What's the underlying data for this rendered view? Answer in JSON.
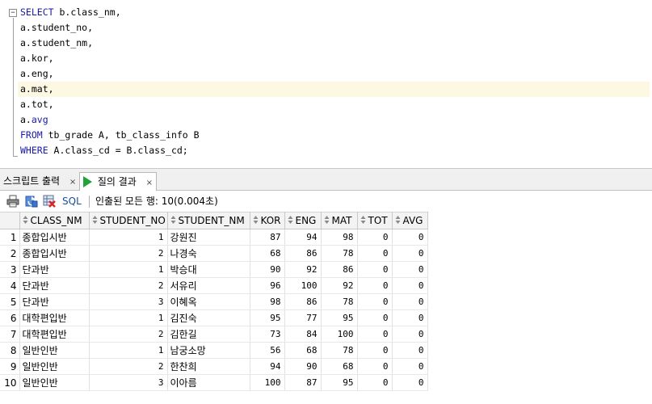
{
  "editor": {
    "lines": [
      {
        "segments": [
          {
            "t": "SELECT ",
            "c": "kw"
          },
          {
            "t": "b.class_nm,",
            "c": ""
          }
        ]
      },
      {
        "segments": [
          {
            "t": "a.student_no,",
            "c": ""
          }
        ]
      },
      {
        "segments": [
          {
            "t": "a.student_nm,",
            "c": ""
          }
        ]
      },
      {
        "segments": [
          {
            "t": "a.kor,",
            "c": ""
          }
        ]
      },
      {
        "segments": [
          {
            "t": "a.eng,",
            "c": ""
          }
        ]
      },
      {
        "segments": [
          {
            "t": "a.mat,",
            "c": ""
          }
        ],
        "highlight": true
      },
      {
        "segments": [
          {
            "t": "a.tot,",
            "c": ""
          }
        ]
      },
      {
        "segments": [
          {
            "t": "a.",
            "c": ""
          },
          {
            "t": "avg",
            "c": "fld"
          }
        ]
      },
      {
        "segments": [
          {
            "t": "FROM ",
            "c": "kw"
          },
          {
            "t": "tb_grade A, tb_class_info B",
            "c": ""
          }
        ]
      },
      {
        "segments": [
          {
            "t": "WHERE ",
            "c": "kw"
          },
          {
            "t": "A.class_cd = B.class_cd;",
            "c": ""
          }
        ]
      }
    ]
  },
  "tabs": [
    {
      "label": "스크립트 출력",
      "close": "×",
      "active": false
    },
    {
      "label": "질의 결과",
      "close": "×",
      "active": true
    }
  ],
  "toolbar": {
    "sql_label": "SQL",
    "status": "인출된 모든 행: 10(0.004초)"
  },
  "grid": {
    "columns": [
      "CLASS_NM",
      "STUDENT_NO",
      "STUDENT_NM",
      "KOR",
      "ENG",
      "MAT",
      "TOT",
      "AVG"
    ],
    "rows": [
      [
        "1",
        "종합입시반",
        "1",
        "강원진",
        "87",
        "94",
        "98",
        "0",
        "0"
      ],
      [
        "2",
        "종합입시반",
        "2",
        "나경숙",
        "68",
        "86",
        "78",
        "0",
        "0"
      ],
      [
        "3",
        "단과반",
        "1",
        "박승대",
        "90",
        "92",
        "86",
        "0",
        "0"
      ],
      [
        "4",
        "단과반",
        "2",
        "서유리",
        "96",
        "100",
        "92",
        "0",
        "0"
      ],
      [
        "5",
        "단과반",
        "3",
        "이혜옥",
        "98",
        "86",
        "78",
        "0",
        "0"
      ],
      [
        "6",
        "대학편입반",
        "1",
        "김진숙",
        "95",
        "77",
        "95",
        "0",
        "0"
      ],
      [
        "7",
        "대학편입반",
        "2",
        "김한길",
        "73",
        "84",
        "100",
        "0",
        "0"
      ],
      [
        "8",
        "일반인반",
        "1",
        "남궁소망",
        "56",
        "68",
        "78",
        "0",
        "0"
      ],
      [
        "9",
        "일반인반",
        "2",
        "한찬희",
        "94",
        "90",
        "68",
        "0",
        "0"
      ],
      [
        "10",
        "일반인반",
        "3",
        "이아름",
        "100",
        "87",
        "95",
        "0",
        "0"
      ]
    ]
  },
  "colors": {
    "keyword": "#1a1aa6",
    "highlight_line": "#fdf8e2",
    "run_icon": "#22a33a"
  },
  "icons": [
    "print-icon",
    "refresh-icon",
    "delete-results-icon",
    "play-icon",
    "fold-minus-icon",
    "sort-icon"
  ]
}
